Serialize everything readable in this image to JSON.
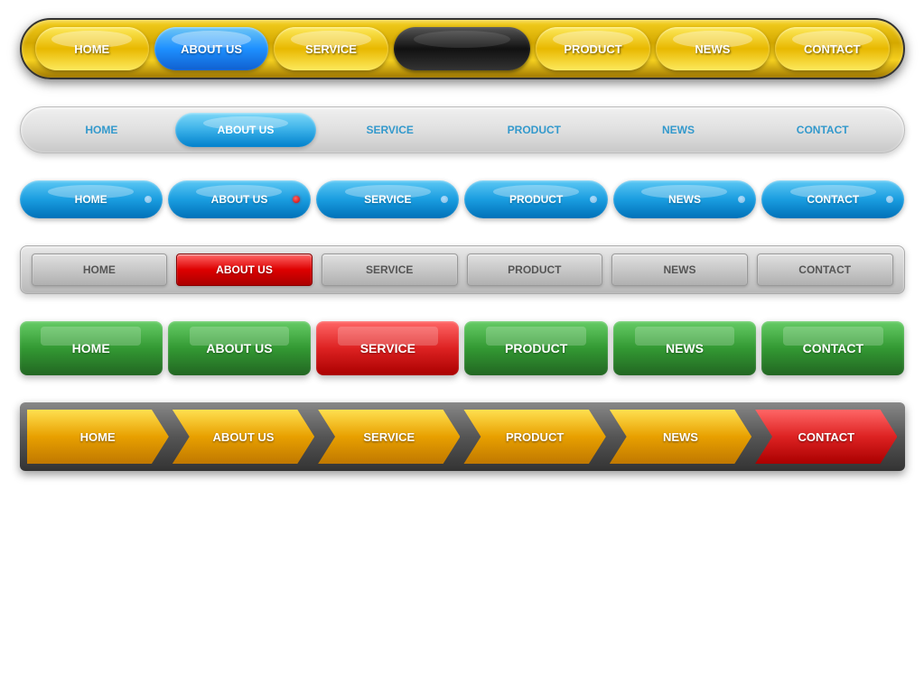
{
  "nav1": {
    "items": [
      {
        "label": "HOME",
        "style": "gold"
      },
      {
        "label": "ABOUT US",
        "style": "blue"
      },
      {
        "label": "SERVICE",
        "style": "gold"
      },
      {
        "label": "",
        "style": "black"
      },
      {
        "label": "PRODUCT",
        "style": "gold"
      },
      {
        "label": "NEWS",
        "style": "gold"
      },
      {
        "label": "CONTACT",
        "style": "gold"
      }
    ]
  },
  "nav2": {
    "items": [
      {
        "label": "HOME",
        "style": "normal"
      },
      {
        "label": "ABOUT US",
        "style": "active"
      },
      {
        "label": "SERVICE",
        "style": "normal"
      },
      {
        "label": "PRODUCT",
        "style": "normal"
      },
      {
        "label": "NEWS",
        "style": "normal"
      },
      {
        "label": "CONTACT",
        "style": "normal"
      }
    ]
  },
  "nav3": {
    "items": [
      {
        "label": "HOME",
        "dot": "light"
      },
      {
        "label": "ABOUT US",
        "dot": "red"
      },
      {
        "label": "SERVICE",
        "dot": "light"
      },
      {
        "label": "PRODUCT",
        "dot": "light"
      },
      {
        "label": "NEWS",
        "dot": "light"
      },
      {
        "label": "CONTACT",
        "dot": "light"
      }
    ]
  },
  "nav4": {
    "items": [
      {
        "label": "HOME",
        "style": "normal"
      },
      {
        "label": "ABOUT US",
        "style": "active-red"
      },
      {
        "label": "SERVICE",
        "style": "normal"
      },
      {
        "label": "PRODUCT",
        "style": "normal"
      },
      {
        "label": "NEWS",
        "style": "normal"
      },
      {
        "label": "CONTACT",
        "style": "normal"
      }
    ]
  },
  "nav5": {
    "items": [
      {
        "label": "HOME",
        "style": "green"
      },
      {
        "label": "ABOUT US",
        "style": "green"
      },
      {
        "label": "SERVICE",
        "style": "red"
      },
      {
        "label": "PRODUCT",
        "style": "green"
      },
      {
        "label": "NEWS",
        "style": "green"
      },
      {
        "label": "CONTACT",
        "style": "green"
      }
    ]
  },
  "nav6": {
    "items": [
      {
        "label": "HOME",
        "style": "yellow",
        "first": true
      },
      {
        "label": "ABOUT US",
        "style": "yellow",
        "first": false
      },
      {
        "label": "SERVICE",
        "style": "yellow",
        "first": false
      },
      {
        "label": "PRODUCT",
        "style": "yellow",
        "first": false
      },
      {
        "label": "NEWS",
        "style": "yellow",
        "first": false
      },
      {
        "label": "CONTACT",
        "style": "red",
        "first": false
      }
    ]
  }
}
